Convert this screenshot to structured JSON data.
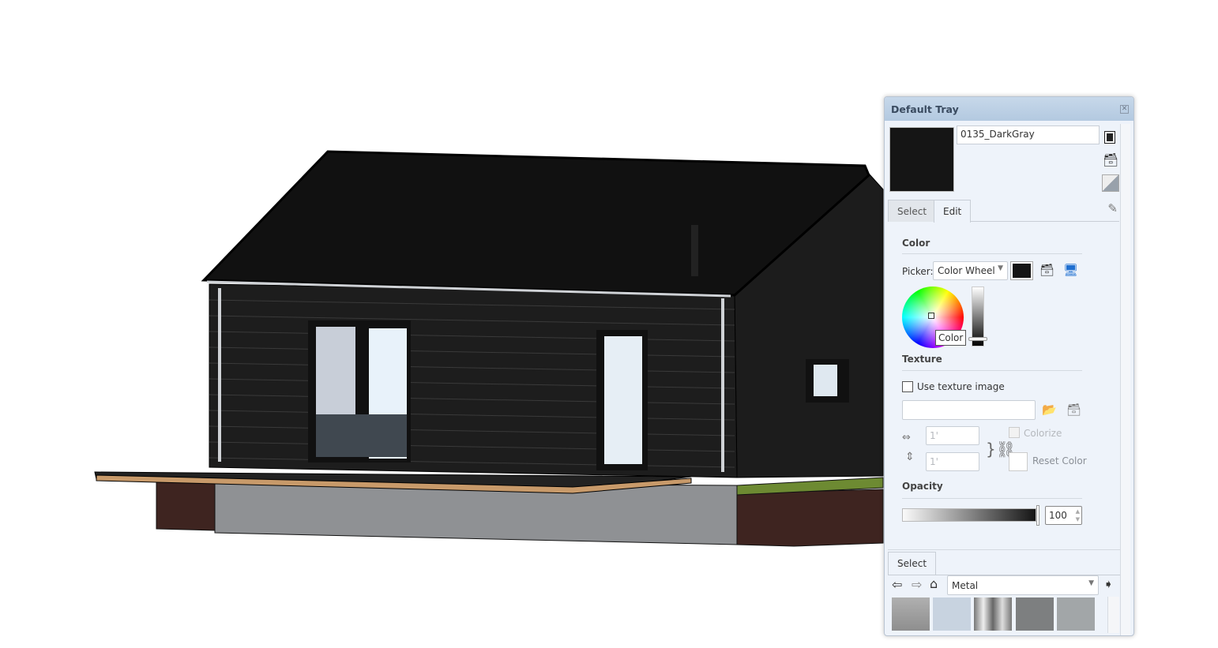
{
  "tray": {
    "title": "Default Tray",
    "material_name": "0135_DarkGray",
    "material_color": "#151515",
    "tabs": [
      "Select",
      "Edit"
    ],
    "active_tab": "Edit",
    "color_section": "Color",
    "picker_label": "Picker:",
    "picker_value": "Color Wheel",
    "tooltip": "Color",
    "texture_section": "Texture",
    "use_texture_label": "Use texture image",
    "use_texture_checked": false,
    "texture_path": "",
    "width_value": "1'",
    "height_value": "1'",
    "colorize_label": "Colorize",
    "reset_color_label": "Reset Color",
    "opacity_section": "Opacity",
    "opacity_value": "100",
    "bottom_tab": "Select",
    "library_value": "Metal"
  }
}
